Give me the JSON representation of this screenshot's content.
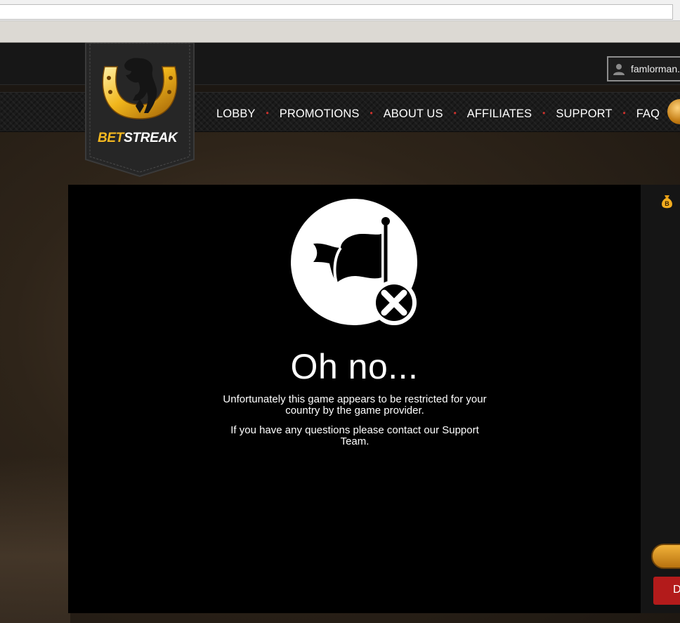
{
  "user": {
    "username": "famlorman."
  },
  "logo": {
    "part1": "BET",
    "part2": "STREAK"
  },
  "nav": {
    "items": [
      {
        "label": "LOBBY"
      },
      {
        "label": "PROMOTIONS"
      },
      {
        "label": "ABOUT US"
      },
      {
        "label": "AFFILIATES"
      },
      {
        "label": "SUPPORT"
      },
      {
        "label": "FAQ"
      }
    ],
    "separator": "•"
  },
  "game": {
    "title": "Oh no...",
    "message": "Unfortunately this game appears to be restricted for your country by the game provider.",
    "contact": "If you have any questions please contact our Support Team.",
    "icon": "flag-restricted-icon"
  },
  "side": {
    "button_label": "D",
    "icon": "moneybag-icon"
  },
  "colors": {
    "accent_gold": "#f4b820",
    "nav_dot": "#d2322d",
    "button_red": "#b31b1b"
  }
}
